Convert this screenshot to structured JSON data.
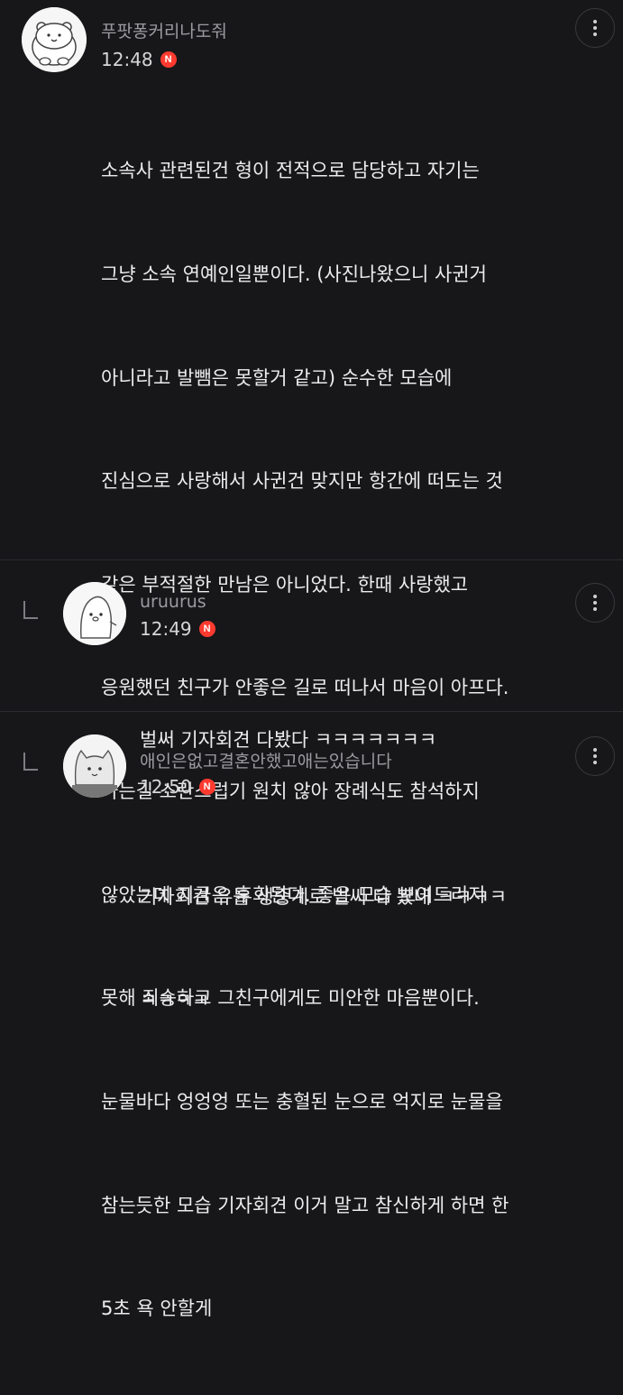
{
  "comments": [
    {
      "nickname": "푸팟퐁커리나도줘",
      "time": "12:48",
      "badge": "N",
      "lines": [
        "소속사 관련된건 형이 전적으로 담당하고 자기는",
        "그냥 소속 연예인일뿐이다. (사진나왔으니 사귄거",
        "아니라고 발뺌은 못할거 같고) 순수한 모습에",
        "진심으로 사랑해서 사귄건 맞지만 항간에 떠도는 것",
        "같은 부적절한 만남은 아니었다. 한때 사랑했고",
        "응원했던 친구가 안좋은 길로 떠나서 마음이 아프다.",
        "가는길 소란스럽기 원치 않아 장례식도 참석하지",
        "않았는데 지금은 후회된다. 좋은 모습 보여드리지",
        "못해 죄송하고 그친구에게도 미안한 마음뿐이다.",
        "눈물바다 엉엉엉 또는 충혈된 눈으로 억지로 눈물을",
        "참는듯한 모습 기자회견 이거 말고 참신하게 하면 한",
        "5초 욕 안할게"
      ]
    },
    {
      "nickname": "uruurus",
      "time": "12:49",
      "badge": "N",
      "lines": [
        "벌써 기자회견 다봤다 ㅋㅋㅋㅋㅋㅋㅋ"
      ]
    },
    {
      "nickname": "애인은없고결혼안했고애는있습니다",
      "time": "12:50",
      "badge": "N",
      "lines": [
        "기자회견 유튭 생중계로 벌써 다 봤네 ㅋㅋㅋㅋ",
        "ㅋㅋㅋㅋ"
      ]
    }
  ],
  "icons": {
    "more": "more-vertical-icon",
    "reply": "reply-arrow-icon"
  },
  "colors": {
    "background": "#171719",
    "badge": "#ff3a2f"
  }
}
